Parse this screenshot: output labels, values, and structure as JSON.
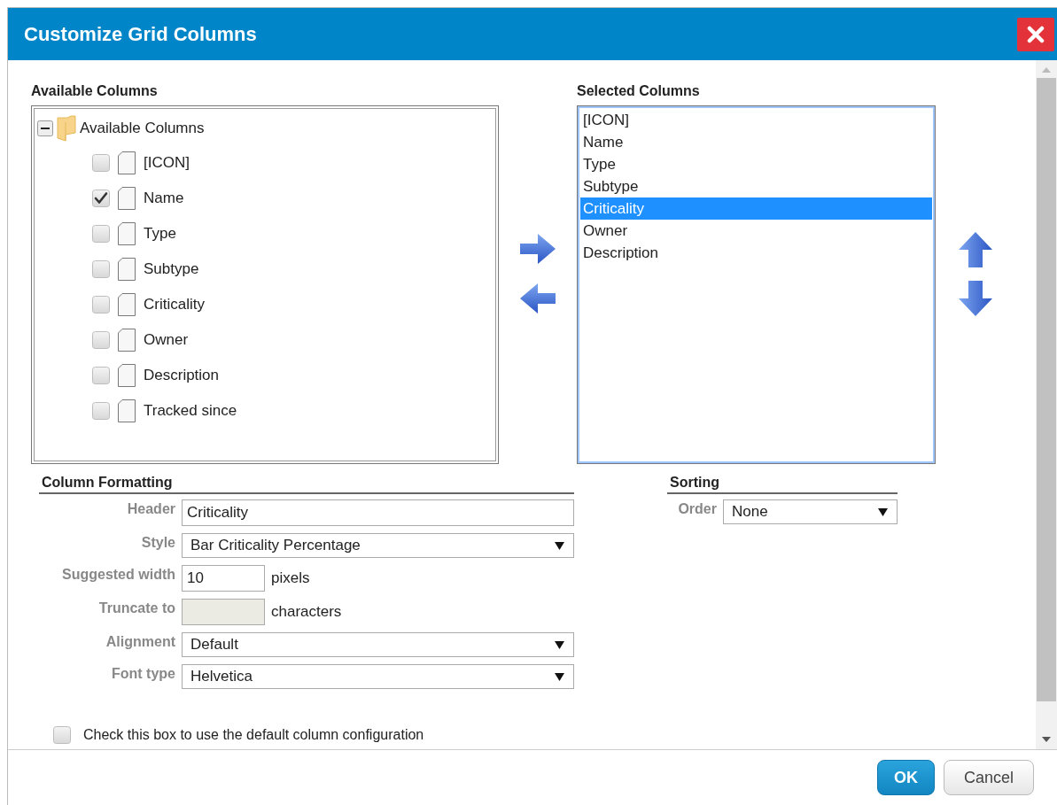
{
  "dialog": {
    "title": "Customize Grid Columns"
  },
  "available": {
    "heading": "Available Columns",
    "tree": {
      "label": "Available Columns",
      "expanded": true,
      "children": [
        {
          "label": "[ICON]",
          "checked": false
        },
        {
          "label": "Name",
          "checked": true
        },
        {
          "label": "Type",
          "checked": false
        },
        {
          "label": "Subtype",
          "checked": false
        },
        {
          "label": "Criticality",
          "checked": false
        },
        {
          "label": "Owner",
          "checked": false
        },
        {
          "label": "Description",
          "checked": false
        },
        {
          "label": "Tracked since",
          "checked": false
        }
      ]
    }
  },
  "selected": {
    "heading": "Selected Columns",
    "items": [
      {
        "label": "[ICON]",
        "selected": false
      },
      {
        "label": "Name",
        "selected": false
      },
      {
        "label": "Type",
        "selected": false
      },
      {
        "label": "Subtype",
        "selected": false
      },
      {
        "label": "Criticality",
        "selected": true
      },
      {
        "label": "Owner",
        "selected": false
      },
      {
        "label": "Description",
        "selected": false
      }
    ]
  },
  "formatting": {
    "heading": "Column Formatting",
    "fields": [
      {
        "kind": "text",
        "label": "Header",
        "value": "Criticality",
        "disabled": false
      },
      {
        "kind": "select",
        "label": "Style",
        "value": "Bar Criticality Percentage",
        "disabled": false
      },
      {
        "kind": "short",
        "label": "Suggested width",
        "value": "10",
        "unit": "pixels",
        "disabled": false
      },
      {
        "kind": "short",
        "label": "Truncate to",
        "unit": "characters",
        "disabled": true
      },
      {
        "kind": "select",
        "label": "Alignment",
        "value": "Default",
        "disabled": false
      },
      {
        "kind": "select",
        "label": "Font type",
        "value": "Helvetica",
        "disabled": false
      }
    ]
  },
  "sorting": {
    "heading": "Sorting",
    "fields": [
      {
        "kind": "select",
        "label": "Order",
        "value": "None",
        "disabled": false
      }
    ]
  },
  "default_checkbox": {
    "label": "Check this box to use the default column configuration",
    "checked": false
  },
  "buttons": [
    {
      "label": "OK",
      "kind": "primary"
    },
    {
      "label": "Cancel",
      "kind": "secondary"
    }
  ]
}
